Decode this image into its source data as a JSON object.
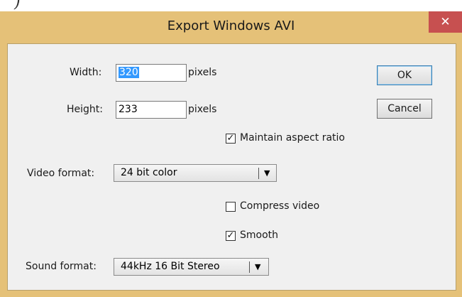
{
  "window": {
    "title": "Export Windows AVI",
    "close_glyph": "✕",
    "frame_color": "#e5c178",
    "close_color": "#c75050"
  },
  "background_fragment": ")",
  "fields": {
    "width_label": "Width:",
    "width_value": "320",
    "width_unit": "pixels",
    "height_label": "Height:",
    "height_value": "233",
    "height_unit": "pixels"
  },
  "buttons": {
    "ok": "OK",
    "cancel": "Cancel"
  },
  "checkboxes": {
    "maintain_aspect_label": "Maintain aspect ratio",
    "maintain_aspect_checked": true,
    "compress_video_label": "Compress video",
    "compress_video_checked": false,
    "smooth_label": "Smooth",
    "smooth_checked": true,
    "check_glyph": "✓"
  },
  "video_format": {
    "label": "Video format:",
    "value": "24 bit color",
    "icon": "chevron-down-icon"
  },
  "sound_format": {
    "label": "Sound format:",
    "value": "44kHz 16 Bit Stereo",
    "icon": "chevron-down-icon"
  }
}
